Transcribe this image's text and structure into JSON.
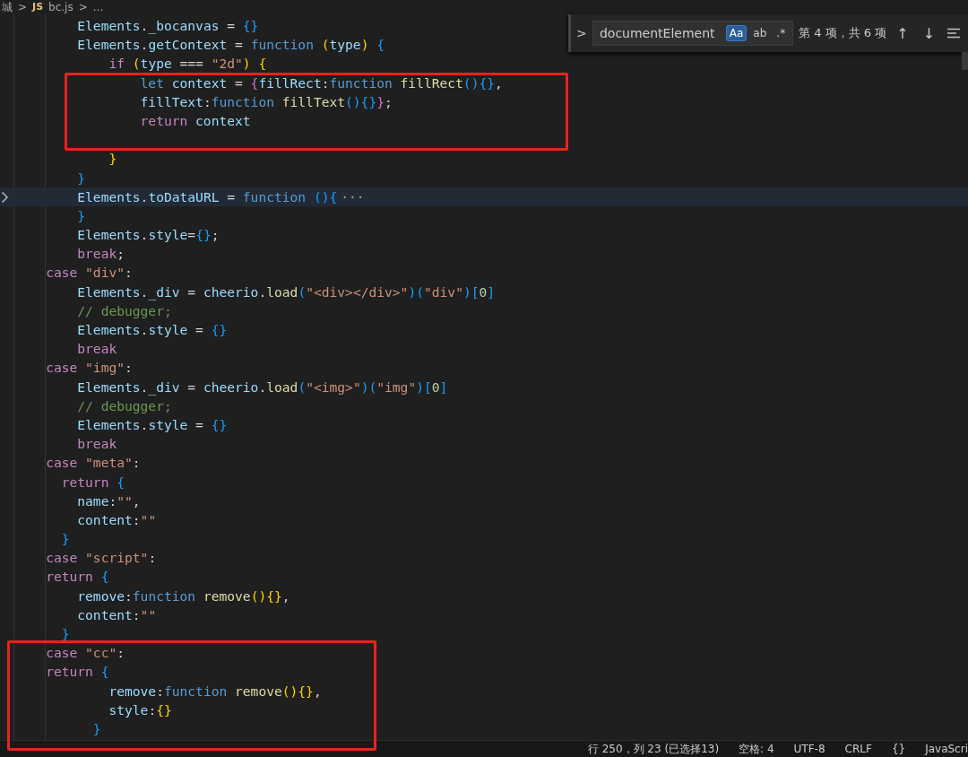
{
  "breadcrumb": [
    {
      "kind": "text",
      "text": "城"
    },
    {
      "kind": "sep",
      "text": ">"
    },
    {
      "kind": "js",
      "text": "JS"
    },
    {
      "kind": "text",
      "text": "bc.js"
    },
    {
      "kind": "sep",
      "text": ">"
    },
    {
      "kind": "text",
      "text": "..."
    }
  ],
  "find_widget": {
    "toggle": ">",
    "value": "documentElement",
    "options": [
      {
        "text": "Aa",
        "on": true
      },
      {
        "text": "ab",
        "on": false
      },
      {
        "text": ".*",
        "on": false
      }
    ],
    "result": "第 4 项，共 6 项",
    "prev": "↑",
    "next": "↓"
  },
  "blocks": [
    {
      "kind": "plain",
      "lines": [
        {
          "kind": "code",
          "tokens": [
            {
              "kind": "var",
              "text": "        Elements"
            },
            {
              "kind": "plain",
              "text": "."
            },
            {
              "kind": "var",
              "text": "_bocanvas"
            },
            {
              "kind": "plain",
              "text": " = "
            },
            {
              "kind": "b3",
              "text": "{}"
            }
          ]
        },
        {
          "kind": "code",
          "tokens": [
            {
              "kind": "var",
              "text": "        Elements"
            },
            {
              "kind": "plain",
              "text": "."
            },
            {
              "kind": "var",
              "text": "getContext"
            },
            {
              "kind": "plain",
              "text": " = "
            },
            {
              "kind": "storage",
              "text": "function"
            },
            {
              "kind": "b1",
              "text": " ("
            },
            {
              "kind": "var",
              "text": "type"
            },
            {
              "kind": "b1",
              "text": ")"
            },
            {
              "kind": "b3",
              "text": " {"
            }
          ]
        },
        {
          "kind": "code",
          "tokens": [
            {
              "kind": "keyword",
              "text": "            if"
            },
            {
              "kind": "b1",
              "text": " ("
            },
            {
              "kind": "var",
              "text": "type"
            },
            {
              "kind": "plain",
              "text": " === "
            },
            {
              "kind": "string",
              "text": "\"2d\""
            },
            {
              "kind": "b1",
              "text": ")"
            },
            {
              "kind": "b1",
              "text": " {"
            }
          ]
        }
      ]
    },
    {
      "kind": "highlighted",
      "lines": [
        {
          "kind": "code",
          "tokens": [
            {
              "kind": "storage",
              "text": "                let"
            },
            {
              "kind": "var",
              "text": " context"
            },
            {
              "kind": "plain",
              "text": " = "
            },
            {
              "kind": "b2",
              "text": "{"
            },
            {
              "kind": "var",
              "text": "fillRect"
            },
            {
              "kind": "plain",
              "text": ":"
            },
            {
              "kind": "storage",
              "text": "function"
            },
            {
              "kind": "fn",
              "text": " fillRect"
            },
            {
              "kind": "b3",
              "text": "(){}"
            },
            {
              "kind": "plain",
              "text": ","
            }
          ]
        },
        {
          "kind": "code",
          "tokens": [
            {
              "kind": "var",
              "text": "                fillText"
            },
            {
              "kind": "plain",
              "text": ":"
            },
            {
              "kind": "storage",
              "text": "function"
            },
            {
              "kind": "fn",
              "text": " fillText"
            },
            {
              "kind": "b3",
              "text": "(){}"
            },
            {
              "kind": "b2",
              "text": "}"
            },
            {
              "kind": "plain",
              "text": ";"
            }
          ]
        },
        {
          "kind": "code",
          "tokens": [
            {
              "kind": "keyword",
              "text": "                return"
            },
            {
              "kind": "var",
              "text": " context"
            }
          ]
        },
        {
          "kind": "blank"
        }
      ]
    },
    {
      "kind": "plain",
      "lines": [
        {
          "kind": "code",
          "tokens": [
            {
              "kind": "b1",
              "text": "            }"
            }
          ]
        },
        {
          "kind": "code",
          "tokens": [
            {
              "kind": "b3",
              "text": "        }"
            }
          ]
        },
        {
          "kind": "code",
          "current": true,
          "folded": true,
          "tokens": [
            {
              "kind": "var",
              "text": "        Elements"
            },
            {
              "kind": "plain",
              "text": "."
            },
            {
              "kind": "var",
              "text": "toDataURL"
            },
            {
              "kind": "plain",
              "text": " = "
            },
            {
              "kind": "storage",
              "text": "function"
            },
            {
              "kind": "b3",
              "text": " (){"
            },
            {
              "kind": "dim",
              "text": "···"
            }
          ]
        },
        {
          "kind": "code",
          "tokens": [
            {
              "kind": "b3",
              "text": "        }"
            }
          ]
        },
        {
          "kind": "code",
          "tokens": [
            {
              "kind": "var",
              "text": "        Elements"
            },
            {
              "kind": "plain",
              "text": "."
            },
            {
              "kind": "var",
              "text": "style"
            },
            {
              "kind": "plain",
              "text": "="
            },
            {
              "kind": "b3",
              "text": "{}"
            },
            {
              "kind": "plain",
              "text": ";"
            }
          ]
        },
        {
          "kind": "code",
          "tokens": [
            {
              "kind": "keyword",
              "text": "        break"
            },
            {
              "kind": "plain",
              "text": ";"
            }
          ]
        },
        {
          "kind": "code",
          "tokens": [
            {
              "kind": "keyword",
              "text": "    case"
            },
            {
              "kind": "string",
              "text": " \"div\""
            },
            {
              "kind": "plain",
              "text": ":"
            }
          ]
        },
        {
          "kind": "code",
          "tokens": [
            {
              "kind": "var",
              "text": "        Elements"
            },
            {
              "kind": "plain",
              "text": "."
            },
            {
              "kind": "var",
              "text": "_div"
            },
            {
              "kind": "plain",
              "text": " = "
            },
            {
              "kind": "var",
              "text": "cheerio"
            },
            {
              "kind": "plain",
              "text": "."
            },
            {
              "kind": "fn",
              "text": "load"
            },
            {
              "kind": "b3",
              "text": "("
            },
            {
              "kind": "string",
              "text": "\"<div></div>\""
            },
            {
              "kind": "b3",
              "text": ")("
            },
            {
              "kind": "string",
              "text": "\"div\""
            },
            {
              "kind": "b3",
              "text": ")["
            },
            {
              "kind": "number",
              "text": "0"
            },
            {
              "kind": "b3",
              "text": "]"
            }
          ]
        },
        {
          "kind": "code",
          "tokens": [
            {
              "kind": "comment",
              "text": "        // debugger;"
            }
          ]
        },
        {
          "kind": "code",
          "tokens": [
            {
              "kind": "var",
              "text": "        Elements"
            },
            {
              "kind": "plain",
              "text": "."
            },
            {
              "kind": "var",
              "text": "style"
            },
            {
              "kind": "plain",
              "text": " = "
            },
            {
              "kind": "b3",
              "text": "{}"
            }
          ]
        },
        {
          "kind": "code",
          "tokens": [
            {
              "kind": "keyword",
              "text": "        break"
            }
          ]
        },
        {
          "kind": "code",
          "tokens": [
            {
              "kind": "keyword",
              "text": "    case"
            },
            {
              "kind": "string",
              "text": " \"img\""
            },
            {
              "kind": "plain",
              "text": ":"
            }
          ]
        },
        {
          "kind": "code",
          "tokens": [
            {
              "kind": "var",
              "text": "        Elements"
            },
            {
              "kind": "plain",
              "text": "."
            },
            {
              "kind": "var",
              "text": "_div"
            },
            {
              "kind": "plain",
              "text": " = "
            },
            {
              "kind": "var",
              "text": "cheerio"
            },
            {
              "kind": "plain",
              "text": "."
            },
            {
              "kind": "fn",
              "text": "load"
            },
            {
              "kind": "b3",
              "text": "("
            },
            {
              "kind": "string",
              "text": "\"<img>\""
            },
            {
              "kind": "b3",
              "text": ")("
            },
            {
              "kind": "string",
              "text": "\"img\""
            },
            {
              "kind": "b3",
              "text": ")["
            },
            {
              "kind": "number",
              "text": "0"
            },
            {
              "kind": "b3",
              "text": "]"
            }
          ]
        },
        {
          "kind": "code",
          "tokens": [
            {
              "kind": "comment",
              "text": "        // debugger;"
            }
          ]
        },
        {
          "kind": "code",
          "tokens": [
            {
              "kind": "var",
              "text": "        Elements"
            },
            {
              "kind": "plain",
              "text": "."
            },
            {
              "kind": "var",
              "text": "style"
            },
            {
              "kind": "plain",
              "text": " = "
            },
            {
              "kind": "b3",
              "text": "{}"
            }
          ]
        },
        {
          "kind": "code",
          "tokens": [
            {
              "kind": "keyword",
              "text": "        break"
            }
          ]
        },
        {
          "kind": "code",
          "tokens": [
            {
              "kind": "keyword",
              "text": "    case"
            },
            {
              "kind": "string",
              "text": " \"meta\""
            },
            {
              "kind": "plain",
              "text": ":"
            }
          ]
        },
        {
          "kind": "code",
          "tokens": [
            {
              "kind": "keyword",
              "text": "      return"
            },
            {
              "kind": "b3",
              "text": " {"
            }
          ]
        },
        {
          "kind": "code",
          "tokens": [
            {
              "kind": "var",
              "text": "        name"
            },
            {
              "kind": "plain",
              "text": ":"
            },
            {
              "kind": "string",
              "text": "\"\""
            },
            {
              "kind": "plain",
              "text": ","
            }
          ]
        },
        {
          "kind": "code",
          "tokens": [
            {
              "kind": "var",
              "text": "        content"
            },
            {
              "kind": "plain",
              "text": ":"
            },
            {
              "kind": "string",
              "text": "\"\""
            }
          ]
        },
        {
          "kind": "code",
          "tokens": [
            {
              "kind": "b3",
              "text": "      }"
            }
          ]
        },
        {
          "kind": "code",
          "tokens": [
            {
              "kind": "keyword",
              "text": "    case"
            },
            {
              "kind": "string",
              "text": " \"script\""
            },
            {
              "kind": "plain",
              "text": ":"
            }
          ]
        },
        {
          "kind": "code",
          "tokens": [
            {
              "kind": "keyword",
              "text": "    return"
            },
            {
              "kind": "b3",
              "text": " {"
            }
          ]
        },
        {
          "kind": "code",
          "tokens": [
            {
              "kind": "var",
              "text": "        remove"
            },
            {
              "kind": "plain",
              "text": ":"
            },
            {
              "kind": "storage",
              "text": "function"
            },
            {
              "kind": "fn",
              "text": " remove"
            },
            {
              "kind": "b1",
              "text": "(){}"
            },
            {
              "kind": "plain",
              "text": ","
            }
          ]
        },
        {
          "kind": "code",
          "tokens": [
            {
              "kind": "var",
              "text": "        content"
            },
            {
              "kind": "plain",
              "text": ":"
            },
            {
              "kind": "string",
              "text": "\"\""
            }
          ]
        },
        {
          "kind": "code",
          "tokens": [
            {
              "kind": "b3",
              "text": "      }"
            }
          ]
        }
      ]
    },
    {
      "kind": "highlighted",
      "lines": [
        {
          "kind": "code",
          "tokens": [
            {
              "kind": "keyword",
              "text": "    case"
            },
            {
              "kind": "string",
              "text": " \"cc\""
            },
            {
              "kind": "plain",
              "text": ":"
            }
          ]
        },
        {
          "kind": "code",
          "tokens": [
            {
              "kind": "keyword",
              "text": "    return"
            },
            {
              "kind": "b3",
              "text": " {"
            }
          ]
        },
        {
          "kind": "code",
          "tokens": [
            {
              "kind": "var",
              "text": "            remove"
            },
            {
              "kind": "plain",
              "text": ":"
            },
            {
              "kind": "storage",
              "text": "function"
            },
            {
              "kind": "fn",
              "text": " remove"
            },
            {
              "kind": "b1",
              "text": "(){}"
            },
            {
              "kind": "plain",
              "text": ","
            }
          ]
        },
        {
          "kind": "code",
          "tokens": [
            {
              "kind": "var",
              "text": "            style"
            },
            {
              "kind": "plain",
              "text": ":"
            },
            {
              "kind": "b1",
              "text": "{}"
            }
          ]
        },
        {
          "kind": "code",
          "tokens": [
            {
              "kind": "b3",
              "text": "          }"
            }
          ]
        }
      ]
    }
  ],
  "status_bar": [
    "行 250，列 23 (已选择13)",
    "空格: 4",
    "UTF-8",
    "CRLF",
    "{}",
    "JavaScri"
  ]
}
